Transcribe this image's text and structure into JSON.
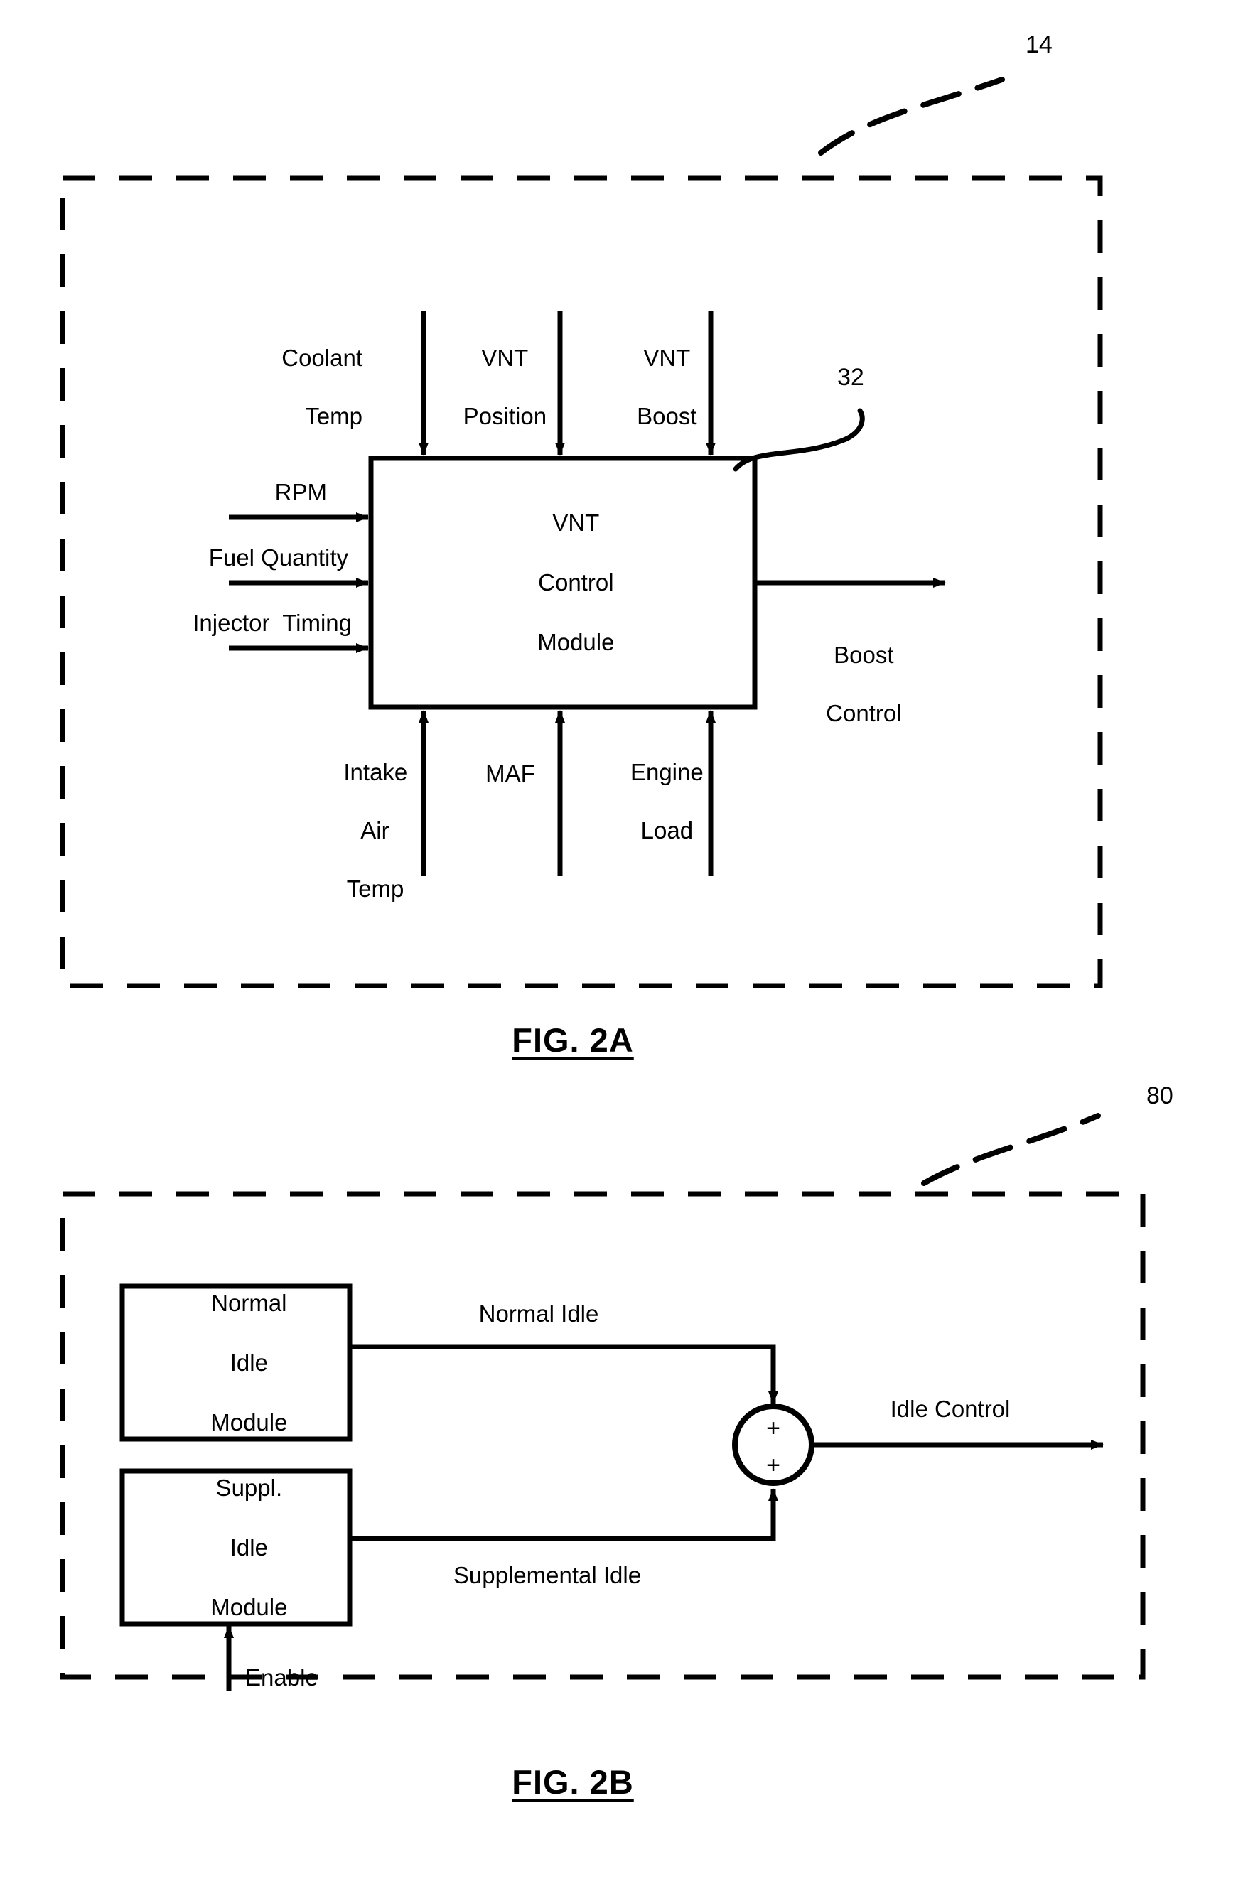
{
  "document": {
    "kind": "patent-figure-sheet",
    "background_color": "#ffffff",
    "ink_color": "#000000"
  },
  "figures": [
    {
      "id": "fig-2a",
      "caption": "FIG. 2A",
      "reference_numeral": "14",
      "module": {
        "reference_numeral": "32",
        "label_lines": [
          "VNT",
          "Control",
          "Module"
        ],
        "label_text": "VNT\nControl\nModule"
      },
      "top_inputs": [
        {
          "label": "Coolant\nTemp",
          "line1": "Coolant",
          "line2": "Temp"
        },
        {
          "label": "VNT\nPosition",
          "line1": "VNT",
          "line2": "Position"
        },
        {
          "label": "VNT\nBoost",
          "line1": "VNT",
          "line2": "Boost"
        }
      ],
      "left_inputs": [
        {
          "label": "RPM"
        },
        {
          "label": "Fuel Quantity"
        },
        {
          "label": "Injector  Timing"
        }
      ],
      "bottom_inputs": [
        {
          "label": "Intake\nAir\nTemp",
          "line1": "Intake",
          "line2": "Air",
          "line3": "Temp"
        },
        {
          "label": "MAF"
        },
        {
          "label": "Engine\nLoad",
          "line1": "Engine",
          "line2": "Load"
        }
      ],
      "outputs": [
        {
          "label": "Boost\nControl",
          "line1": "Boost",
          "line2": "Control"
        }
      ]
    },
    {
      "id": "fig-2b",
      "caption": "FIG. 2B",
      "reference_numeral": "80",
      "modules": [
        {
          "id": "normal-idle-module",
          "label_lines": [
            "Normal",
            "Idle",
            "Module"
          ],
          "label_text": "Normal\nIdle\nModule"
        },
        {
          "id": "suppl-idle-module",
          "label_lines": [
            "Suppl.",
            "Idle",
            "Module"
          ],
          "label_text": "Suppl.\nIdle\nModule"
        }
      ],
      "signals": [
        {
          "id": "normal-idle-signal",
          "label": "Normal Idle"
        },
        {
          "id": "supplemental-idle-signal",
          "label": "Supplemental Idle"
        },
        {
          "id": "enable-signal",
          "label": "Enable"
        },
        {
          "id": "idle-control-signal",
          "label": "Idle Control"
        }
      ],
      "summing_junction": {
        "id": "summing-junction",
        "operators": [
          "+",
          "+"
        ],
        "shape": "circle"
      }
    }
  ]
}
